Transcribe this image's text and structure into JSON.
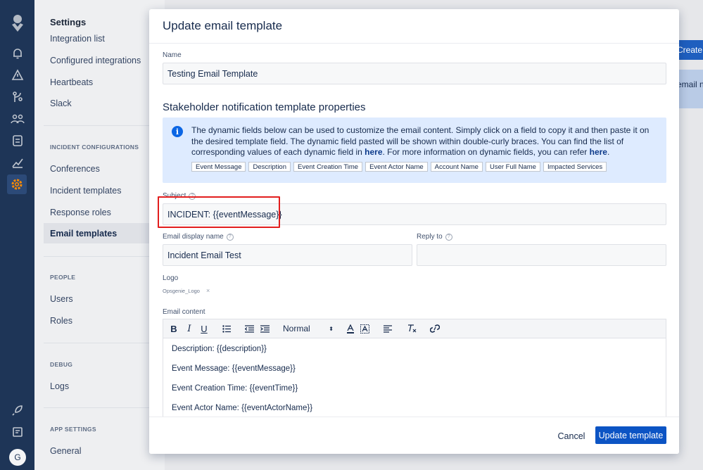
{
  "sidebar": {
    "settings_title": "Settings",
    "group1": [
      {
        "label": "Integration list"
      },
      {
        "label": "Configured integrations"
      },
      {
        "label": "Heartbeats"
      },
      {
        "label": "Slack"
      }
    ],
    "incident_section": "INCIDENT CONFIGURATIONS",
    "group2": [
      {
        "label": "Conferences"
      },
      {
        "label": "Incident templates"
      },
      {
        "label": "Response roles"
      },
      {
        "label": "Email templates",
        "active": true
      }
    ],
    "people_section": "PEOPLE",
    "group3": [
      {
        "label": "Users"
      },
      {
        "label": "Roles"
      }
    ],
    "debug_section": "DEBUG",
    "group4": [
      {
        "label": "Logs"
      }
    ],
    "app_section": "APP SETTINGS",
    "group5": [
      {
        "label": "General"
      }
    ]
  },
  "background": {
    "create_button": "Create n",
    "info_text": "email n"
  },
  "user": {
    "initial": "G"
  },
  "modal": {
    "title": "Update email template",
    "name_label": "Name",
    "name_value": "Testing Email Template",
    "section_title": "Stakeholder notification template properties",
    "info": {
      "text1": "The dynamic fields below can be used to customize the email content. Simply click on a field to copy it and then paste it on the desired template field. The dynamic field pasted will be shown within double-curly braces. You can find the list of corresponding values of each dynamic field in ",
      "link1": "here",
      "text2": ". For more information on dynamic fields, you can refer ",
      "link2": "here",
      "text3": "."
    },
    "dynamic_fields": [
      "Event Message",
      "Description",
      "Event Creation Time",
      "Event Actor Name",
      "Account Name",
      "User Full Name",
      "Impacted Services"
    ],
    "subject_label": "Subject",
    "subject_value": "INCIDENT: {{eventMessage}}",
    "display_name_label": "Email display name",
    "display_name_value": "Incident Email Test",
    "reply_to_label": "Reply to",
    "reply_to_value": "",
    "logo_label": "Logo",
    "logo_file": "Opsgenie_Logo",
    "content_label": "Email content",
    "format_select": "Normal",
    "content_lines": [
      "Description: {{description}}",
      "Event Message: {{eventMessage}}",
      "Event Creation Time: {{eventTime}}",
      "Event Actor Name: {{eventActorName}}"
    ],
    "cancel": "Cancel",
    "submit": "Update template"
  },
  "colors": {
    "rail": "#1e3557",
    "primary": "#0c54c4",
    "highlight": "#e21d1d",
    "info_bg": "#deebff"
  }
}
